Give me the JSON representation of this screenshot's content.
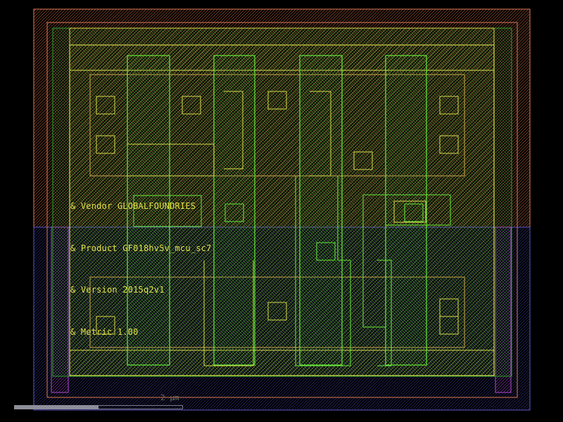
{
  "annotations": {
    "vendor": "& Vendor GLOBALFOUNDRIES",
    "product": "& Product GF018hv5v_mcu_sc7",
    "version": "& Version 2015q2v1",
    "metric": "& Metric 1.00"
  },
  "scale_bar": {
    "label": "2 µm",
    "fill_fraction": 0.5
  },
  "colors": {
    "background": "#000000",
    "nwell_outline": "#e07a56",
    "pwell_outline": "#5a57c8",
    "diff_green": "#2aa02a",
    "poly_green": "#66e83a",
    "metal_yellow": "#d8d94a",
    "implant_magenta": "#b04ad0",
    "text_yellow": "#e3e04a"
  }
}
